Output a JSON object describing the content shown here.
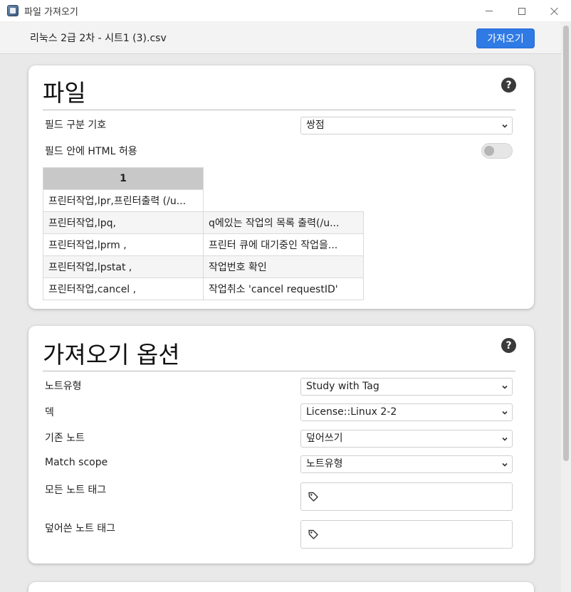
{
  "window": {
    "title": "파일 가져오기"
  },
  "topbar": {
    "filename": "리눅스 2급 2차 - 시트1 (3).csv",
    "import_label": "가져오기"
  },
  "file_section": {
    "title": "파일",
    "help": "?",
    "delimiter_label": "필드 구분 기호",
    "delimiter_value": "쌍점",
    "html_label": "필드 안에 HTML 허용",
    "preview": {
      "headers": [
        "1",
        ""
      ],
      "rows": [
        [
          "프린터작업,lpr,프린터출력 (/u...",
          ""
        ],
        [
          "프린터작업,lpq,",
          "q에있는 작업의 목록 출력(/u..."
        ],
        [
          "프린터작업,lprm ,",
          "프린터 큐에 대기중인 작업을..."
        ],
        [
          "프린터작업,lpstat ,",
          "작업번호 확인"
        ],
        [
          "프린터작업,cancel ,",
          "작업취소 'cancel requestID'"
        ]
      ]
    }
  },
  "options_section": {
    "title": "가져오기 옵션",
    "help": "?",
    "notetype_label": "노트유형",
    "notetype_value": "Study with Tag",
    "deck_label": "덱",
    "deck_value": "License::Linux 2-2",
    "existing_label": "기존 노트",
    "existing_value": "덮어쓰기",
    "match_label": "Match scope",
    "match_value": "노트유형",
    "all_tags_label": "모든 노트 태그",
    "updated_tags_label": "덮어쓴 노트 태그"
  },
  "icons": {
    "help": "help-circle-icon",
    "chevron": "chevron-down-icon",
    "tag": "tag-icon"
  },
  "colors": {
    "accent": "#2f7ae5",
    "background": "#e9e9e9",
    "card": "#ffffff",
    "header_cell": "#c8c8c8"
  }
}
